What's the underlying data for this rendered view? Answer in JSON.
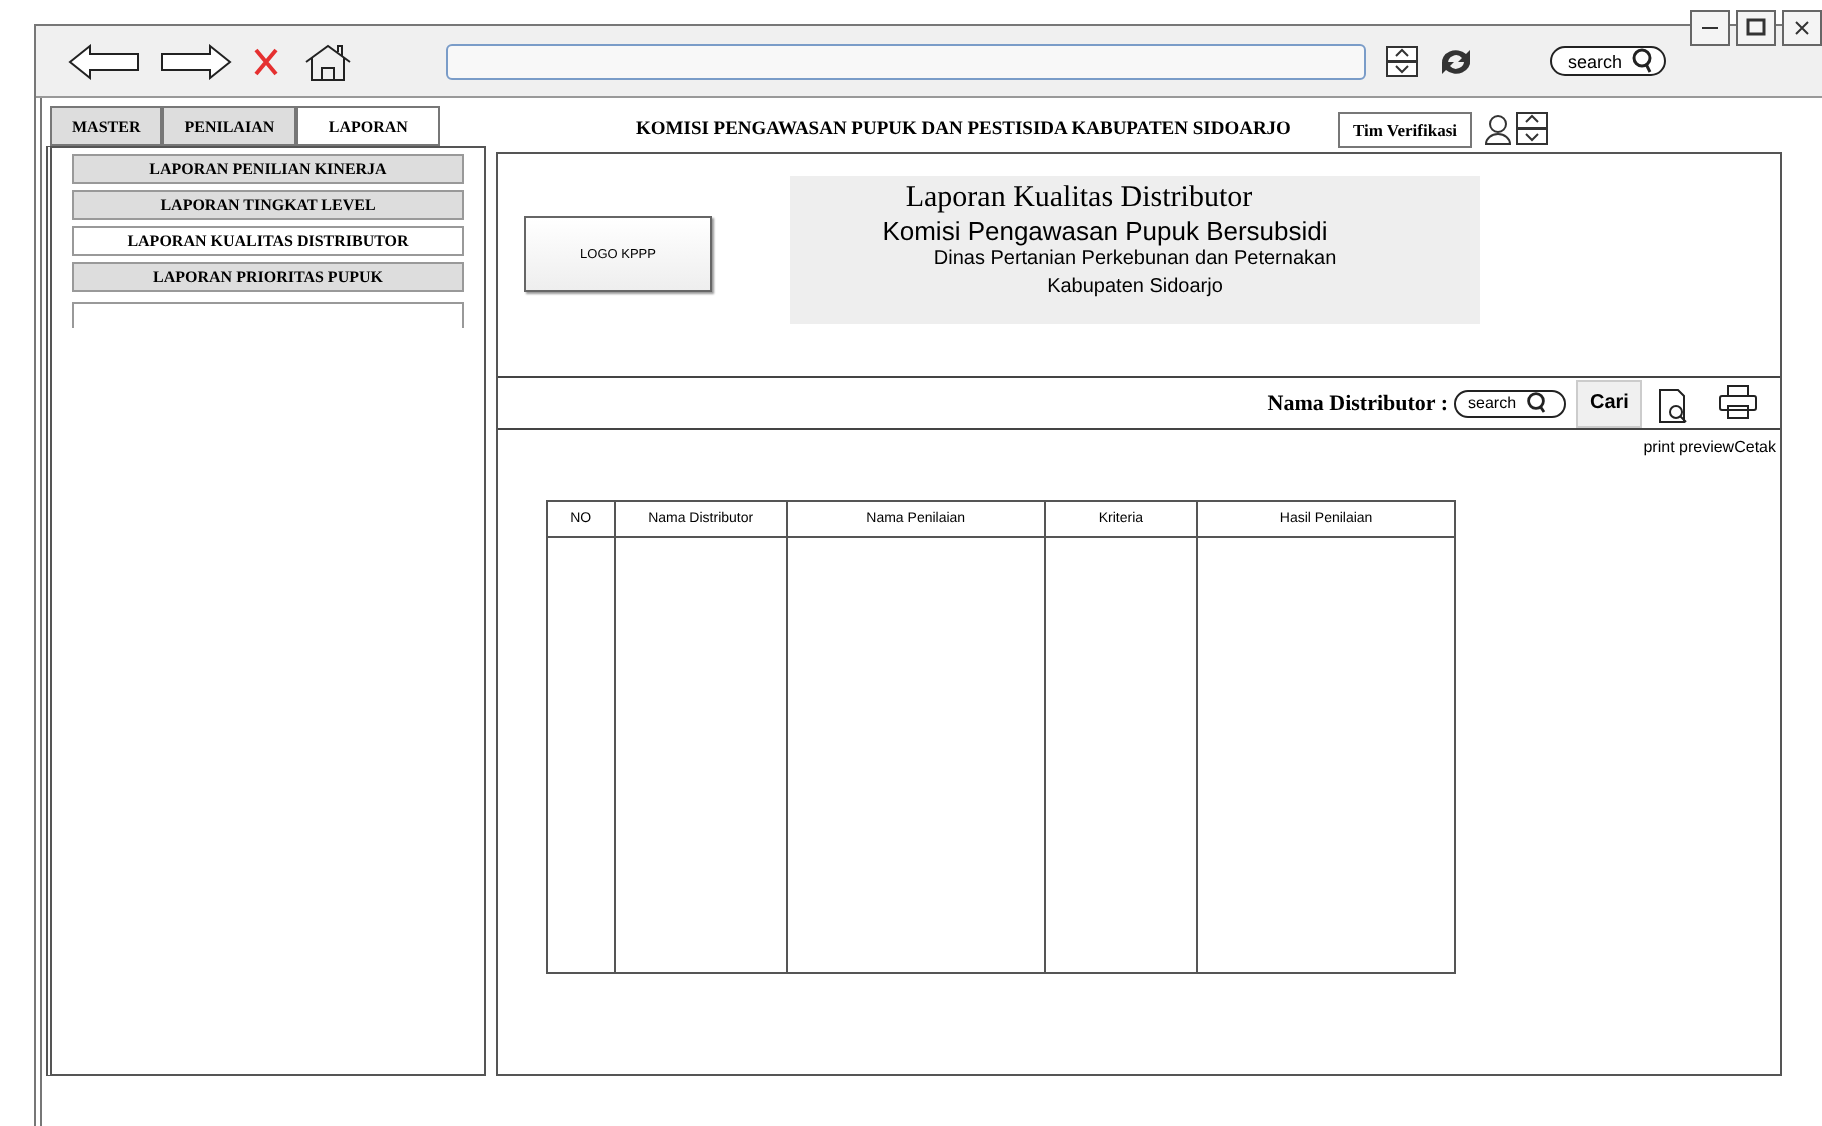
{
  "toolbar": {
    "search": {
      "placeholder": "search"
    }
  },
  "tabs": [
    {
      "label": "MASTER",
      "selected": false
    },
    {
      "label": "PENILAIAN",
      "selected": false
    },
    {
      "label": "LAPORAN",
      "selected": true
    }
  ],
  "header": {
    "title": "KOMISI PENGAWASAN PUPUK DAN PESTISIDA KABUPATEN SIDOARJO",
    "user_button": "Tim Verifikasi"
  },
  "sidebar": {
    "items": [
      {
        "label": "LAPORAN PENILIAN KINERJA",
        "selected": false
      },
      {
        "label": "LAPORAN TINGKAT LEVEL",
        "selected": false
      },
      {
        "label": "LAPORAN KUALITAS DISTRIBUTOR",
        "selected": true
      },
      {
        "label": "LAPORAN PRIORITAS PUPUK",
        "selected": false
      }
    ]
  },
  "report_header": {
    "logo": "LOGO KPPP",
    "title": "Laporan Kualitas Distributor",
    "subtitle": "Komisi Pengawasan Pupuk Bersubsidi",
    "lines": [
      "Dinas Pertanian Perkebunan dan Peternakan",
      "Kabupaten Sidoarjo"
    ]
  },
  "filter": {
    "label": "Nama Distributor :",
    "placeholder": "search",
    "button": "Cari"
  },
  "actions": [
    {
      "kind": "preview",
      "label": "print preview"
    },
    {
      "kind": "print",
      "label": "Cetak"
    }
  ],
  "table": {
    "columns": [
      "NO",
      "Nama Distributor",
      "Nama Penilaian",
      "Kriteria",
      "Hasil Penilaian"
    ]
  }
}
